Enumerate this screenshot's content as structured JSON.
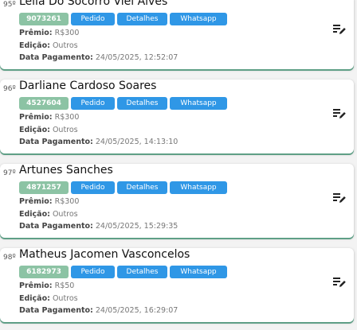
{
  "labels": {
    "pedido": "Pedido",
    "detalhes": "Detalhes",
    "whatsapp": "Whatsapp",
    "premio": "Prêmio:",
    "edicao": "Edição:",
    "data_pagamento": "Data Pagamento:"
  },
  "icons": {
    "edit": "edit-list-icon"
  },
  "colors": {
    "badge": "#8cc3a4",
    "button": "#2f97e6",
    "card_border": "#5f9f86"
  },
  "items": [
    {
      "rank": "95º",
      "name": "Leila Do Socorro Viei Alves",
      "id": "9073261",
      "premio": "R$300",
      "edicao": "Outros",
      "data": "24/05/2025, 12:52:07"
    },
    {
      "rank": "96º",
      "name": "Darliane Cardoso Soares",
      "id": "4527604",
      "premio": "R$300",
      "edicao": "Outros",
      "data": "24/05/2025, 14:13:10"
    },
    {
      "rank": "97º",
      "name": "Artunes Sanches",
      "id": "4871257",
      "premio": "R$300",
      "edicao": "Outros",
      "data": "24/05/2025, 15:29:35"
    },
    {
      "rank": "98º",
      "name": "Matheus Jacomen Vasconcelos",
      "id": "6182973",
      "premio": "R$50",
      "edicao": "Outros",
      "data": "24/05/2025, 16:29:07"
    }
  ]
}
